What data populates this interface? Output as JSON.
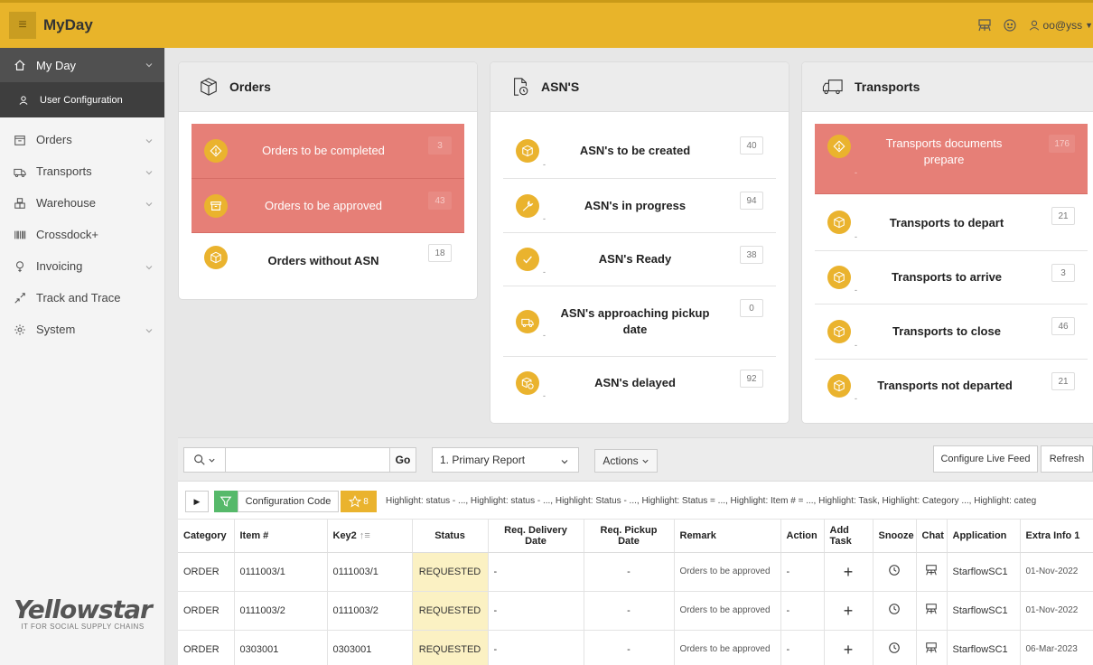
{
  "app": {
    "title": "MyDay",
    "user": "oo@yss"
  },
  "colors": {
    "accent": "#e8b42a",
    "highlight_row": "#e67f77",
    "status_bg": "#fbf1c3",
    "filter_green": "#56b96a"
  },
  "sidebar": {
    "active": {
      "label": "My Day",
      "icon": "home-icon"
    },
    "sub_active": {
      "label": "User Configuration",
      "icon": "user-icon"
    },
    "items": [
      {
        "label": "Orders",
        "icon": "orders-icon",
        "has_children": true
      },
      {
        "label": "Transports",
        "icon": "truck-icon",
        "has_children": true
      },
      {
        "label": "Warehouse",
        "icon": "warehouse-icon",
        "has_children": true
      },
      {
        "label": "Crossdock+",
        "icon": "barcode-icon",
        "has_children": false
      },
      {
        "label": "Invoicing",
        "icon": "invoice-icon",
        "has_children": true
      },
      {
        "label": "Track and Trace",
        "icon": "track-icon",
        "has_children": false
      },
      {
        "label": "System",
        "icon": "gear-icon",
        "has_children": true
      }
    ],
    "logo": {
      "name": "Yellowstar",
      "tagline": "IT FOR SOCIAL SUPPLY CHAINS"
    }
  },
  "cards": {
    "orders": {
      "title": "Orders",
      "rows": [
        {
          "label": "Orders to be completed",
          "count": "3",
          "highlight": true,
          "icon": "alert-icon"
        },
        {
          "label": "Orders to be approved",
          "count": "43",
          "highlight": true,
          "icon": "archive-icon"
        },
        {
          "label": "Orders without ASN",
          "count": "18",
          "highlight": false,
          "icon": "box-icon"
        }
      ]
    },
    "asn": {
      "title": "ASN'S",
      "rows": [
        {
          "label": "ASN's to be created",
          "count": "40",
          "dash": "-",
          "icon": "box-icon"
        },
        {
          "label": "ASN's in progress",
          "count": "94",
          "dash": "-",
          "icon": "wrench-icon"
        },
        {
          "label": "ASN's Ready",
          "count": "38",
          "dash": "-",
          "icon": "check-icon"
        },
        {
          "label": "ASN's approaching pickup date",
          "count": "0",
          "dash": "-",
          "icon": "truck-icon"
        },
        {
          "label": "ASN's delayed",
          "count": "92",
          "dash": "-",
          "icon": "box-clock-icon"
        }
      ]
    },
    "transports": {
      "title": "Transports",
      "rows": [
        {
          "label": "Transports documents prepare",
          "count": "176",
          "dash": "-",
          "highlight": true,
          "icon": "alert-icon"
        },
        {
          "label": "Transports to depart",
          "count": "21",
          "dash": "-",
          "icon": "box-icon"
        },
        {
          "label": "Transports to arrive",
          "count": "3",
          "dash": "-",
          "icon": "box-icon"
        },
        {
          "label": "Transports to close",
          "count": "46",
          "dash": "-",
          "icon": "box-icon"
        },
        {
          "label": "Transports not departed",
          "count": "21",
          "dash": "-",
          "icon": "box-icon"
        }
      ]
    }
  },
  "toolbar": {
    "search_value": "",
    "go_label": "Go",
    "report_select": "1. Primary Report",
    "actions_label": "Actions",
    "configure_label": "Configure Live Feed",
    "refresh_label": "Refresh"
  },
  "filterbar": {
    "config_label": "Configuration Code",
    "highlight_count": "8",
    "highlights_text": "Highlight: status - ..., Highlight: status - ..., Highlight: Status - ..., Highlight: Status = ..., Highlight: Item # = ..., Highlight: Task, Highlight: Category ..., Highlight: categ"
  },
  "table": {
    "columns": [
      "Category",
      "Item #",
      "Key2",
      "Status",
      "Req. Delivery Date",
      "Req. Pickup Date",
      "Remark",
      "Action",
      "Add Task",
      "Snooze",
      "Chat",
      "Application",
      "Extra Info 1"
    ],
    "rows": [
      {
        "category": "ORDER",
        "item": "0111003/1",
        "key2": "0111003/1",
        "status": "REQUESTED",
        "delivery": "-",
        "pickup": "-",
        "remark": "Orders to be approved",
        "action": "-",
        "add": "+",
        "app": "StarflowSC1",
        "extra": "01-Nov-2022"
      },
      {
        "category": "ORDER",
        "item": "0111003/2",
        "key2": "0111003/2",
        "status": "REQUESTED",
        "delivery": "-",
        "pickup": "-",
        "remark": "Orders to be approved",
        "action": "-",
        "add": "+",
        "app": "StarflowSC1",
        "extra": "01-Nov-2022"
      },
      {
        "category": "ORDER",
        "item": "0303001",
        "key2": "0303001",
        "status": "REQUESTED",
        "delivery": "-",
        "pickup": "-",
        "remark": "Orders to be approved",
        "action": "-",
        "add": "+",
        "app": "StarflowSC1",
        "extra": "06-Mar-2023"
      }
    ]
  }
}
